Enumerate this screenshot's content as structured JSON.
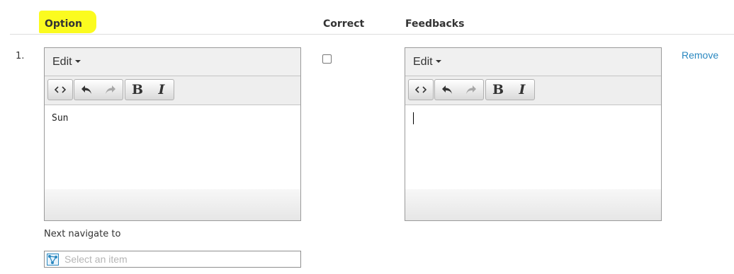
{
  "header": {
    "option_label": "Option",
    "correct_label": "Correct",
    "feedbacks_label": "Feedbacks",
    "highlight_color": "#fbfb1f"
  },
  "rows": [
    {
      "number": "1.",
      "option_editor": {
        "menu_label": "Edit",
        "toolbar": [
          "code-icon",
          "undo-icon",
          "redo-icon",
          "bold-icon",
          "italic-icon"
        ],
        "bold_glyph": "B",
        "italic_glyph": "I",
        "content": "Sun"
      },
      "correct_checked": false,
      "feedback_editor": {
        "menu_label": "Edit",
        "toolbar": [
          "code-icon",
          "undo-icon",
          "redo-icon",
          "bold-icon",
          "italic-icon"
        ],
        "bold_glyph": "B",
        "italic_glyph": "I",
        "content": ""
      },
      "remove_label": "Remove",
      "remove_color": "#2a88c0",
      "next_navigate": {
        "label": "Next navigate to",
        "placeholder": "Select an item",
        "icon": "tree-select-icon"
      }
    }
  ]
}
